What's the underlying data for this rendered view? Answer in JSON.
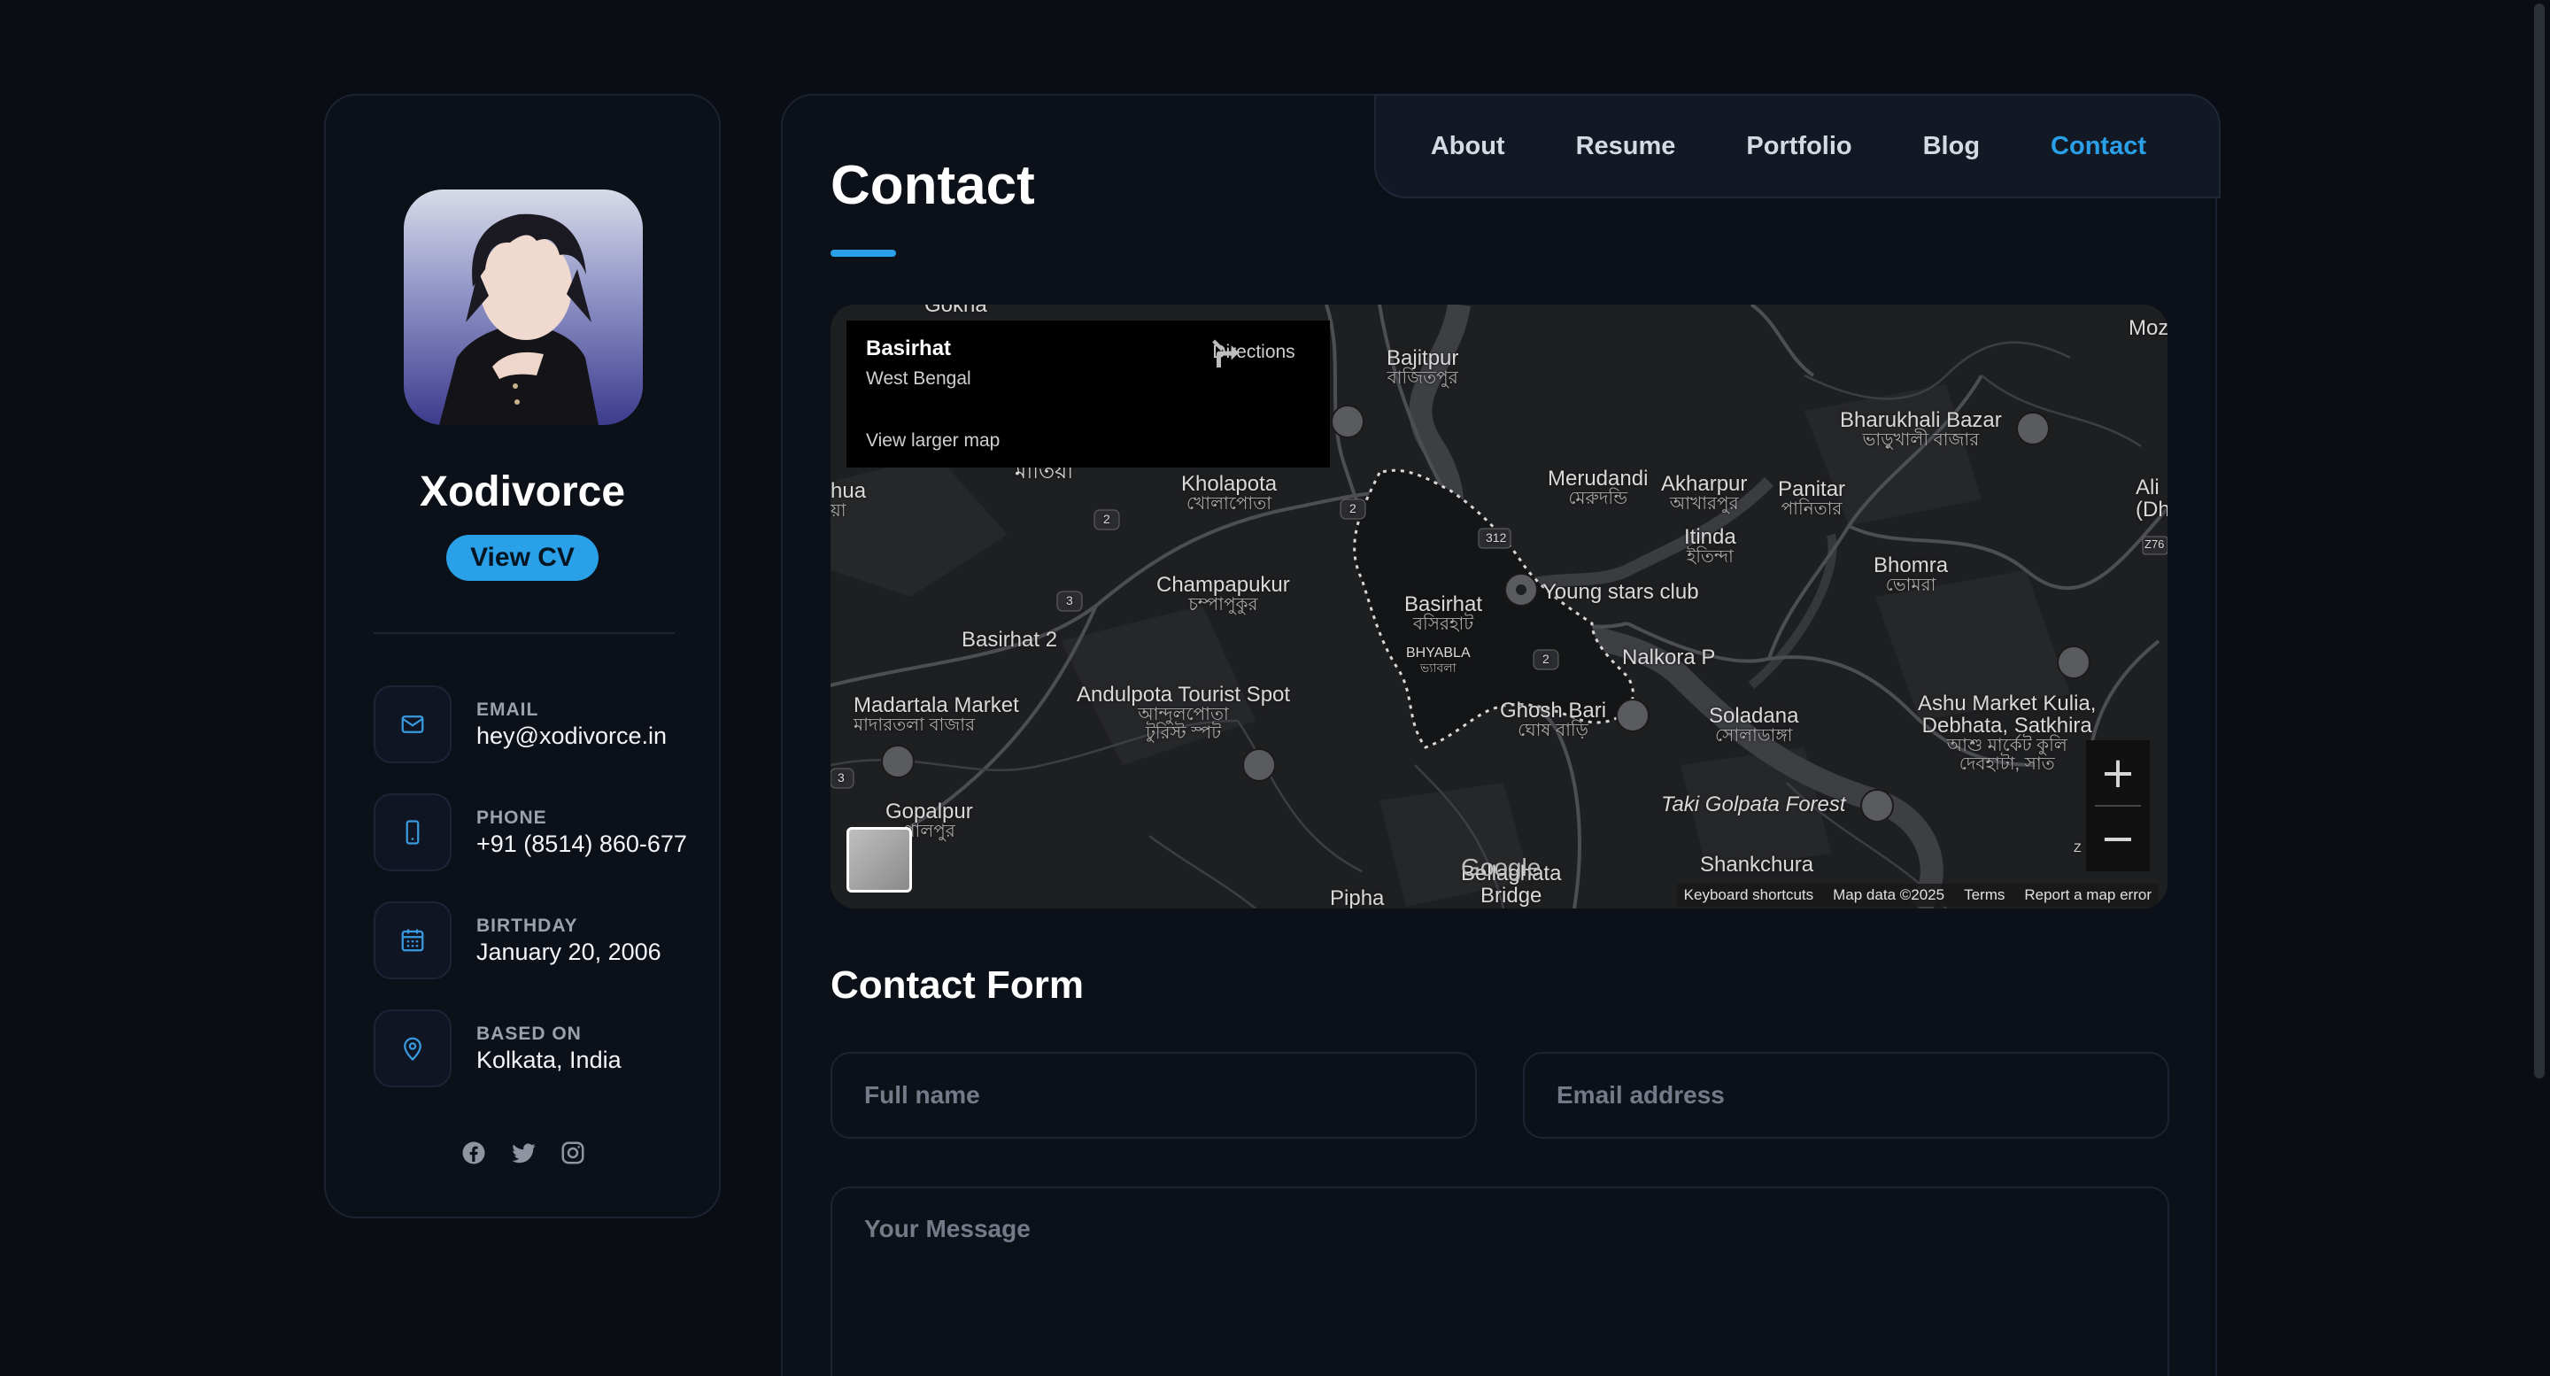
{
  "profile": {
    "name": "Xodivorce",
    "cv_button": "View CV",
    "contacts": [
      {
        "label": "EMAIL",
        "value": "hey@xodivorce.in",
        "icon": "mail-icon"
      },
      {
        "label": "PHONE",
        "value": "+91 (8514) 860-677",
        "icon": "phone-icon"
      },
      {
        "label": "BIRTHDAY",
        "value": "January 20, 2006",
        "icon": "calendar-icon"
      },
      {
        "label": "BASED ON",
        "value": "Kolkata, India",
        "icon": "location-pin-icon"
      }
    ],
    "socials": [
      "facebook-icon",
      "twitter-icon",
      "instagram-icon"
    ]
  },
  "nav": {
    "items": [
      "About",
      "Resume",
      "Portfolio",
      "Blog",
      "Contact"
    ],
    "active": "Contact"
  },
  "page": {
    "title": "Contact"
  },
  "map": {
    "card": {
      "place": "Basirhat",
      "region": "West Bengal",
      "directions": "Directions",
      "larger_map": "View larger map"
    },
    "labels": {
      "gokna": "Gokna",
      "bajitpur": "Bajitpur",
      "bajitpur_bn": "বাজিতপুর",
      "moz": "Moz",
      "bharukhali": "Bharukhali Bazar",
      "bharukhali_bn": "ভাড়ুখালী বাজার",
      "matia_bn": "মাতিয়া",
      "hua": "hua",
      "hua_bn": "য়া",
      "kholapota": "Kholapota",
      "kholapota_bn": "খোলাপোতা",
      "merudandi": "Merudandi",
      "merudandi_bn": "মেরুদন্ডি",
      "akharpur": "Akharpur",
      "akharpur_bn": "আখারপুর",
      "panitar": "Panitar",
      "panitar_bn": "পানিতার",
      "ali": "Ali",
      "ali_dh": "(Dh",
      "itinda": "Itinda",
      "itinda_bn": "ইতিন্দা",
      "champapukur": "Champapukur",
      "champapukur_bn": "চম্পাপুকুর",
      "basirhat": "Basirhat",
      "basirhat_bn": "বসিরহাট",
      "young_stars": "Young stars club",
      "bhomra": "Bhomra",
      "bhomra_bn": "ভোমরা",
      "basirhat2": "Basirhat 2",
      "bhyabla": "BHYABLA",
      "bhyabla_bn": "ভ্যাবলা",
      "nalkora": "Nalkora P",
      "ashu_market": "Ashu Market Kulia,",
      "ashu_market2": "Debhata, Satkhira",
      "ashu_market_bn": "আশু মার্কেট কুলি",
      "ashu_market_bn2": "দেবহাটা, সাত",
      "madartala": "Madartala Market",
      "madartala_bn": "মাদারতলা বাজার",
      "andulpota": "Andulpota Tourist Spot",
      "andulpota_bn": "আন্দুলপোতা",
      "andulpota_bn2": "টুরিস্ট স্পট",
      "ghosh_bari": "Ghosh Bari",
      "ghosh_bari_bn": "ঘোষ বাড়ি",
      "soladana": "Soladana",
      "soladana_bn": "সোলাডাঙ্গা",
      "gopalpur": "Gopalpur",
      "gopalpur_bn": "পালপুর",
      "taki": "Taki Golpata Forest",
      "shankchura": "Shankchura",
      "pipha": "Pipha",
      "bellaghata": "Bellaghata",
      "bridge": "Bridge",
      "road_312": "312",
      "road_2": "2",
      "road_3": "3",
      "road_z76": "Z76",
      "road_z": "Z"
    },
    "google": "Google",
    "footer": [
      "Keyboard shortcuts",
      "Map data ©2025",
      "Terms",
      "Report a map error"
    ]
  },
  "form": {
    "title": "Contact Form",
    "fullname_placeholder": "Full name",
    "email_placeholder": "Email address",
    "message_placeholder": "Your Message"
  },
  "colors": {
    "accent": "#2aa0e8",
    "background": "#0a0d13",
    "card": "#0c1018"
  }
}
